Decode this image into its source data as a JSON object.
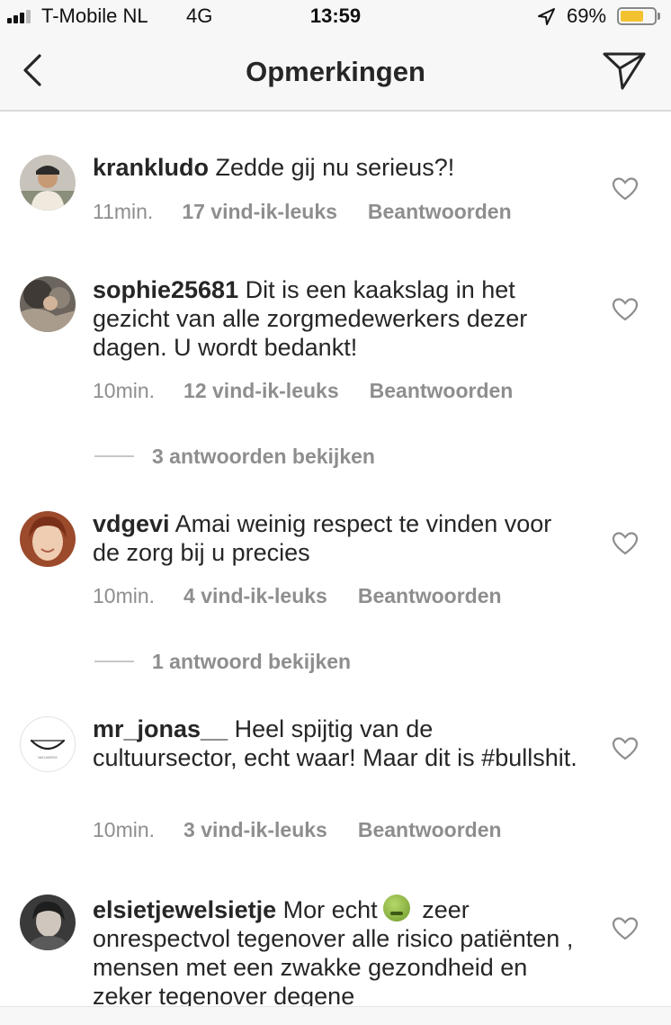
{
  "status_bar": {
    "carrier": "T-Mobile NL",
    "network": "4G",
    "time": "13:59",
    "battery_percent": "69%",
    "battery_level": 0.69,
    "battery_color": "#f2c230",
    "icons": [
      "signal-icon",
      "location-arrow-icon",
      "battery-icon"
    ]
  },
  "header": {
    "title": "Opmerkingen",
    "back_icon": "chevron-left-icon",
    "send_icon": "paper-plane-icon"
  },
  "comments": [
    {
      "username": "krankludo",
      "text": "Zedde gij nu serieus?!",
      "time": "11min.",
      "likes": "17 vind-ik-leuks",
      "reply_label": "Beantwoorden"
    },
    {
      "username": "sophie25681",
      "text": "Dit is een kaakslag in het gezicht van alle zorgmedewerkers dezer dagen. U wordt bedankt!",
      "time": "10min.",
      "likes": "12 vind-ik-leuks",
      "reply_label": "Beantwoorden",
      "view_replies": "3 antwoorden bekijken"
    },
    {
      "username": "vdgevi",
      "text": "Amai weinig respect te vinden voor de zorg bij u precies",
      "time": "10min.",
      "likes": "4 vind-ik-leuks",
      "reply_label": "Beantwoorden",
      "view_replies": "1 antwoord bekijken"
    },
    {
      "username": "mr_jonas__",
      "text": "Heel spijtig van de cultuursector, echt waar! Maar dit is #bullshit.",
      "time": "10min.",
      "likes": "3 vind-ik-leuks",
      "reply_label": "Beantwoorden",
      "avatar_logo_text": "NIEUWENS"
    },
    {
      "username": "elsietjewelsietje",
      "text_before_emoji": "Mor echt",
      "emoji": "nauseated-face-emoji",
      "text_after_emoji": "zeer onrespectvol tegenover alle risico patiënten , mensen met een zwakke gezondheid en zeker tegenover degene"
    }
  ]
}
